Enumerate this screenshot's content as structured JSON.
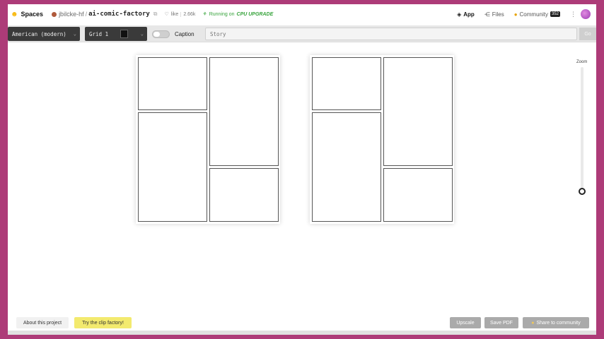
{
  "header": {
    "spaces_label": "Spaces",
    "user": "jbilcke-hf",
    "separator": "/",
    "space_name": "ai-comic-factory",
    "like_label": "like",
    "like_count": "2.66k",
    "status_text": "Running on",
    "status_hardware": "CPU UPGRADE",
    "nav": [
      {
        "label": "App",
        "icon": "app-icon"
      },
      {
        "label": "Files",
        "icon": "files-icon"
      },
      {
        "label": "Community",
        "icon": "community-icon",
        "badge": "352"
      }
    ]
  },
  "toolbar": {
    "style_select": "American (modern)",
    "layout_select": "Grid 1",
    "caption_toggle": false,
    "caption_label": "Caption",
    "story_placeholder": "Story",
    "go_label": "Go"
  },
  "canvas": {
    "pages": 2,
    "panels_per_page": 4,
    "zoom_label": "Zoom",
    "zoom_level": 0.14
  },
  "footer": {
    "about_label": "About this project",
    "clip_label": "Try the clip factory!",
    "upscale_label": "Upscale",
    "save_pdf_label": "Save PDF",
    "share_label": "Share to community"
  }
}
